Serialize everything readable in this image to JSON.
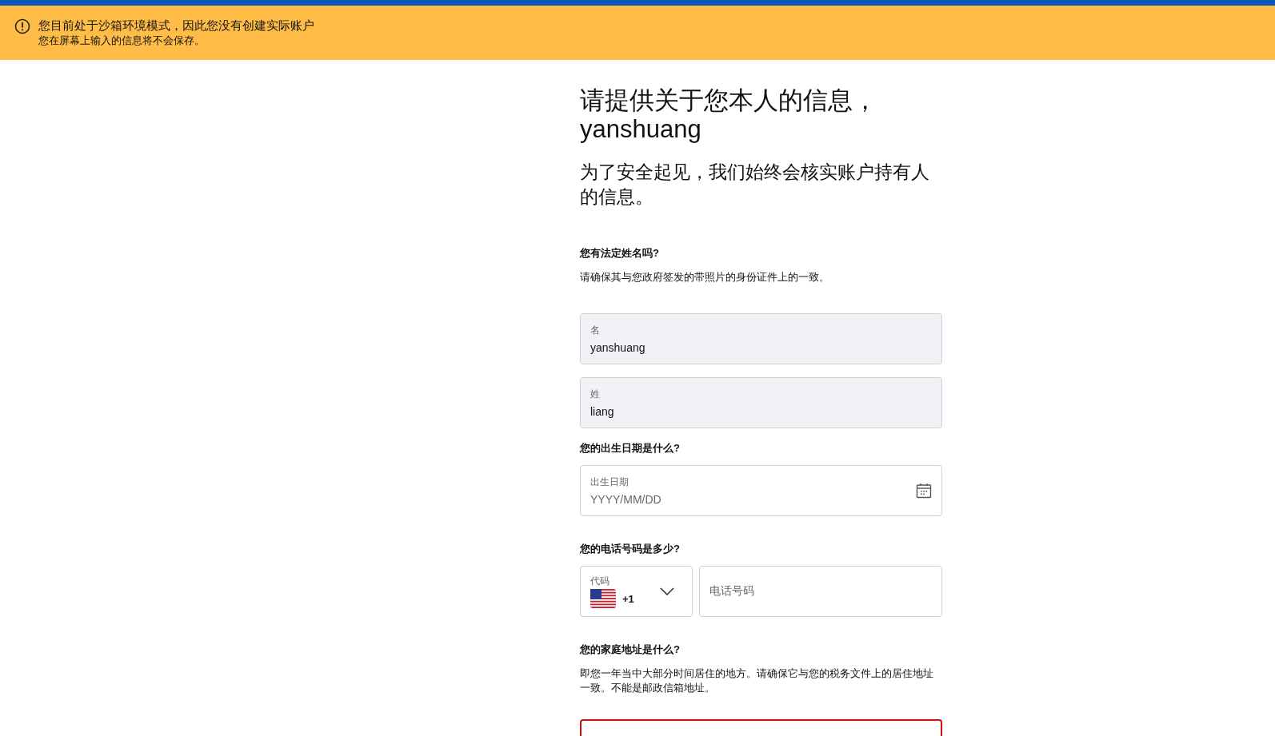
{
  "banner": {
    "title": "您目前处于沙箱环境模式，因此您没有创建实际账户",
    "message": "您在屏幕上输入的信息将不会保存。"
  },
  "heading": "请提供关于您本人的信息，yanshuang",
  "subheading": "为了安全起见，我们始终会核实账户持有人的信息。",
  "name_section": {
    "question": "您有法定姓名吗?",
    "hint": "请确保其与您政府签发的带照片的身份证件上的一致。",
    "fields": [
      {
        "label": "名",
        "value": "yanshuang"
      },
      {
        "label": "姓",
        "value": "liang"
      }
    ]
  },
  "birth_section": {
    "question": "您的出生日期是什么?",
    "field": {
      "label": "出生日期",
      "placeholder": "YYYY/MM/DD"
    }
  },
  "phone_section": {
    "question": "您的电话号码是多少?",
    "code": {
      "label": "代码",
      "value": "+1"
    },
    "number": {
      "placeholder": "电话号码"
    }
  },
  "address_section": {
    "question": "您的家庭地址是什么?",
    "hint": "即您一年当中大部分时间居住的地方。请确保它与您的税务文件上的居住地址一致。不能是邮政信箱地址。",
    "field": {
      "invalid": true
    }
  }
}
